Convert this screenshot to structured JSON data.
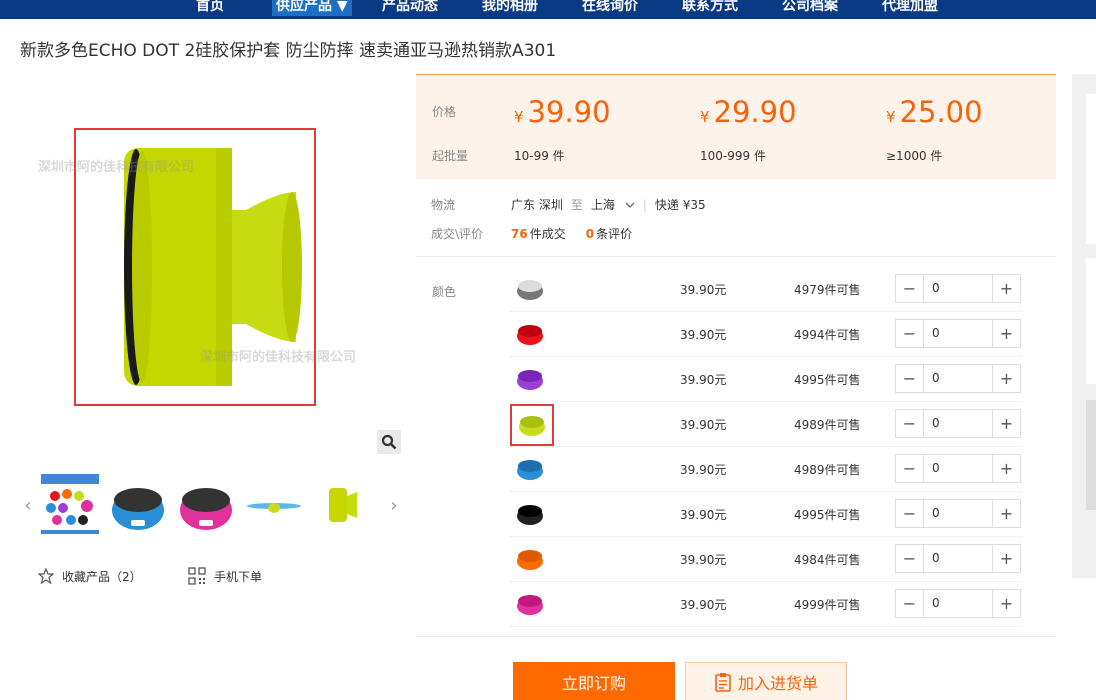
{
  "nav": {
    "items": [
      {
        "label": "首页",
        "active": false
      },
      {
        "label": "供应产品 ▼",
        "active": true
      },
      {
        "label": "产品动态",
        "active": false
      },
      {
        "label": "我的相册",
        "active": false
      },
      {
        "label": "在线询价",
        "active": false
      },
      {
        "label": "联系方式",
        "active": false
      },
      {
        "label": "公司档案",
        "active": false
      },
      {
        "label": "代理加盟",
        "active": false
      }
    ]
  },
  "product": {
    "title": "新款多色ECHO DOT 2硅胶保护套 防尘防摔 速卖通亚马逊热销款A301",
    "watermark": "深圳市阿的佳科技有限公司"
  },
  "gallery": {
    "thumb_count": 5
  },
  "actions": {
    "favorite_label": "收藏产品（2）",
    "mobile_order_label": "手机下单"
  },
  "pricing": {
    "price_label": "价格",
    "moq_label": "起批量",
    "currency": "¥",
    "tiers": [
      {
        "price": "39.90",
        "qty": "10-99 件"
      },
      {
        "price": "29.90",
        "qty": "100-999 件"
      },
      {
        "price": "25.00",
        "qty": "≥1000 件"
      }
    ]
  },
  "logistics": {
    "label": "物流",
    "from": "广东 深圳",
    "to_word": "至",
    "dest": "上海",
    "shipping": "快递 ¥35"
  },
  "deals": {
    "label": "成交\\评价",
    "sold_count": "76",
    "sold_suffix": "件成交",
    "review_count": "0",
    "review_suffix": "条评价"
  },
  "sku": {
    "label": "颜色",
    "rows": [
      {
        "color": "#777777",
        "rim": "#dddddd",
        "price": "39.90元",
        "stock": "4979件可售",
        "qty": "0",
        "selected": false
      },
      {
        "color": "#e8141c",
        "rim": "#c00010",
        "price": "39.90元",
        "stock": "4994件可售",
        "qty": "0",
        "selected": false
      },
      {
        "color": "#9b3fd6",
        "rim": "#7a24b8",
        "price": "39.90元",
        "stock": "4995件可售",
        "qty": "0",
        "selected": false
      },
      {
        "color": "#c8dc1e",
        "rim": "#a9bf12",
        "price": "39.90元",
        "stock": "4989件可售",
        "qty": "0",
        "selected": true
      },
      {
        "color": "#2a8fd8",
        "rim": "#1b6fb0",
        "price": "39.90元",
        "stock": "4989件可售",
        "qty": "0",
        "selected": false
      },
      {
        "color": "#222222",
        "rim": "#000000",
        "price": "39.90元",
        "stock": "4995件可售",
        "qty": "0",
        "selected": false
      },
      {
        "color": "#ff6a00",
        "rim": "#e05800",
        "price": "39.90元",
        "stock": "4984件可售",
        "qty": "0",
        "selected": false
      },
      {
        "color": "#e0329a",
        "rim": "#c01a80",
        "price": "39.90元",
        "stock": "4999件可售",
        "qty": "0",
        "selected": false
      }
    ]
  },
  "buttons": {
    "order_now": "立即订购",
    "add_to_list": "加入进货单"
  },
  "colors": {
    "nav_bg": "#0a3a84",
    "accent": "#f7630c",
    "selection": "#e0393e"
  }
}
